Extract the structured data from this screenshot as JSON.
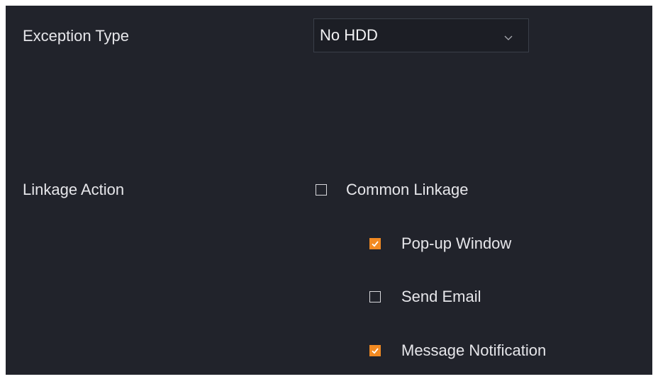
{
  "exception_type": {
    "label": "Exception Type",
    "selected_value": "No HDD"
  },
  "linkage_action": {
    "label": "Linkage Action",
    "options": [
      {
        "label": "Common Linkage",
        "checked": false
      },
      {
        "label": "Pop-up Window",
        "checked": true
      },
      {
        "label": "Send Email",
        "checked": false
      },
      {
        "label": "Message Notification",
        "checked": true
      }
    ]
  },
  "colors": {
    "background": "#21232b",
    "text": "#e6e6ea",
    "accent": "#f28a22",
    "border": "#3a3f49"
  },
  "icons": {
    "select_arrow": "chevron-down-icon",
    "checked": "check-icon"
  }
}
